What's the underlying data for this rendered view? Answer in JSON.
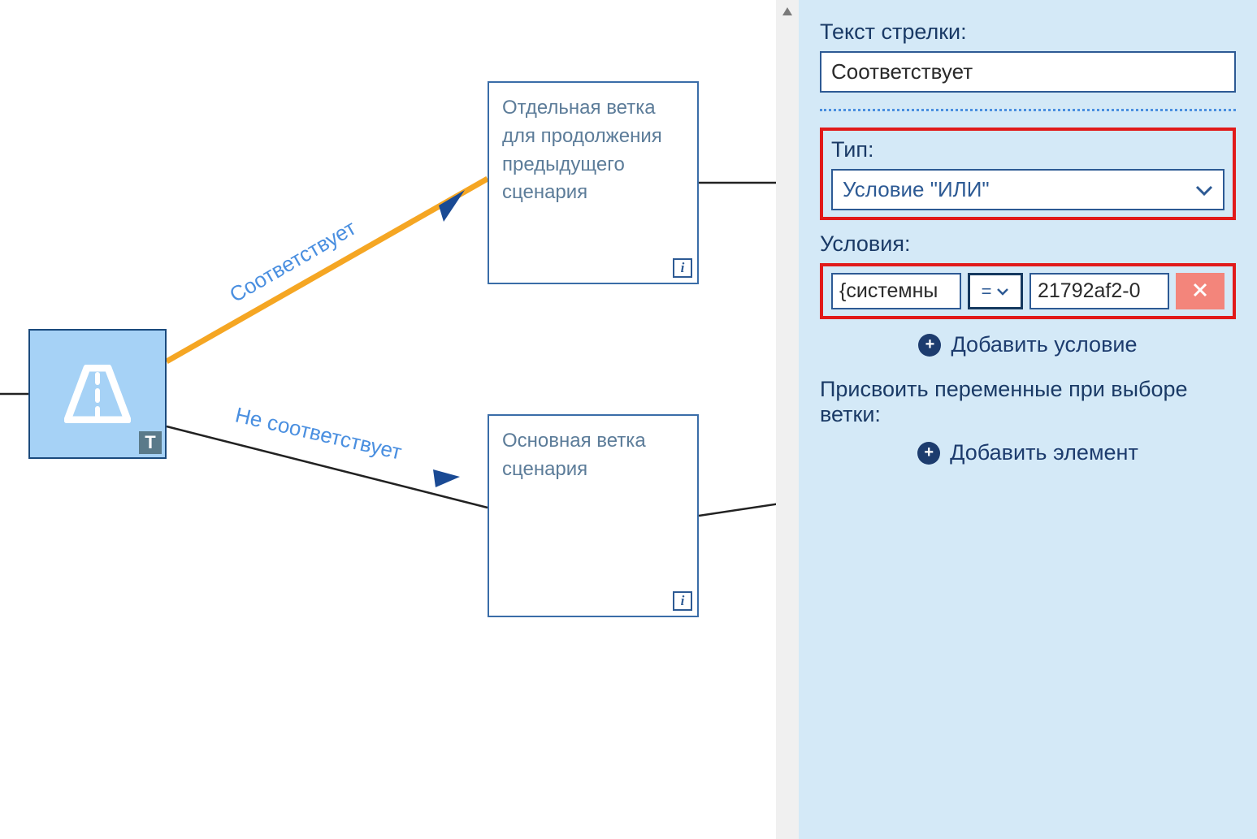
{
  "canvas": {
    "startNode": {
      "badge": "T"
    },
    "edges": {
      "top": {
        "label": "Соответствует"
      },
      "bottom": {
        "label": "Не соответствует"
      }
    },
    "branches": {
      "top": {
        "text": "Отдельная ветка для продолжения предыдущего сценария"
      },
      "bottom": {
        "text": "Основная ветка сценария"
      }
    }
  },
  "panel": {
    "arrowTextLabel": "Текст стрелки:",
    "arrowTextValue": "Соответствует",
    "typeLabel": "Тип:",
    "typeValue": "Условие \"ИЛИ\"",
    "conditionsLabel": "Условия:",
    "condition": {
      "left": "{системны",
      "op": "=",
      "right": "21792af2-0"
    },
    "addConditionLabel": "Добавить условие",
    "assignLabel": "Присвоить переменные при выборе ветки:",
    "addElementLabel": "Добавить элемент"
  }
}
